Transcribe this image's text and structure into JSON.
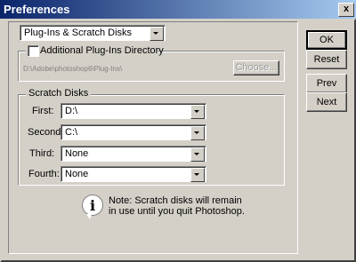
{
  "window": {
    "title": "Preferences",
    "close_glyph": "x"
  },
  "section_select": {
    "value": "Plug-Ins & Scratch Disks"
  },
  "plugins": {
    "checkbox_label": "Additional Plug-Ins Directory",
    "checked": false,
    "path": "D:\\Adobe\\photoshop6\\Plug-Ins\\",
    "choose_label": "Choose..."
  },
  "scratch": {
    "group_label": "Scratch Disks",
    "disks": [
      {
        "label": "First:",
        "value": "D:\\"
      },
      {
        "label": "Second:",
        "value": "C:\\"
      },
      {
        "label": "Third:",
        "value": "None"
      },
      {
        "label": "Fourth:",
        "value": "None"
      }
    ]
  },
  "note": {
    "line1": "Note: Scratch disks will remain",
    "line2": "in use until you quit Photoshop."
  },
  "buttons": {
    "ok": "OK",
    "reset": "Reset",
    "prev": "Prev",
    "next": "Next"
  }
}
